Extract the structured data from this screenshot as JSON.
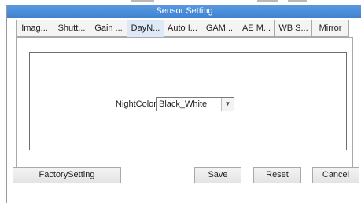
{
  "window": {
    "title": "Sensor Setting"
  },
  "tabs": [
    {
      "label": "Imag..."
    },
    {
      "label": "Shutt..."
    },
    {
      "label": "Gain ..."
    },
    {
      "label": "DayN..."
    },
    {
      "label": "Auto I..."
    },
    {
      "label": "GAM..."
    },
    {
      "label": "AE M..."
    },
    {
      "label": "WB S..."
    },
    {
      "label": "Mirror"
    }
  ],
  "active_tab": "DayN...",
  "night_color": {
    "label": "NightColor",
    "selected": "Black_White"
  },
  "buttons": {
    "factory": "FactorySetting",
    "save": "Save",
    "reset": "Reset",
    "cancel": "Cancel"
  },
  "colors": {
    "titlebar": "#4a8ad8",
    "title_text": "#ffffff"
  }
}
